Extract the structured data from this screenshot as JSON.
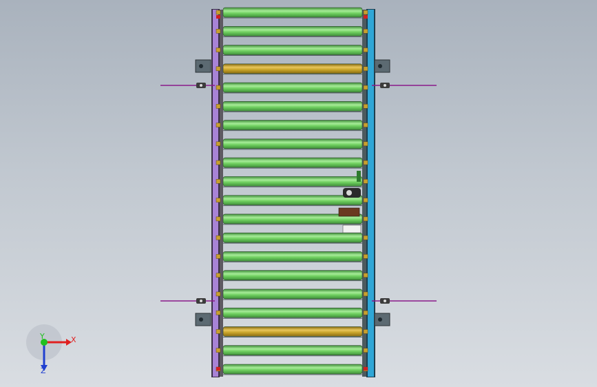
{
  "viewport": {
    "background_top": "#a9b2bd",
    "background_bottom": "#d9dde2"
  },
  "colors": {
    "roller_green": "#6fcf5f",
    "roller_yellow": "#c9a52a",
    "left_frame": "#a883d6",
    "right_frame": "#2fa6d6",
    "wire": "#8a1a8a",
    "bracket": "#5c6a72"
  },
  "conveyor": {
    "roller_count": 20,
    "yellow_roller_indices": [
      3,
      17
    ]
  },
  "triad": {
    "x_label": "X",
    "y_label": "Y",
    "z_label": "Z",
    "x_color": "#e02020",
    "y_color": "#20c020",
    "z_color": "#2040d0"
  }
}
